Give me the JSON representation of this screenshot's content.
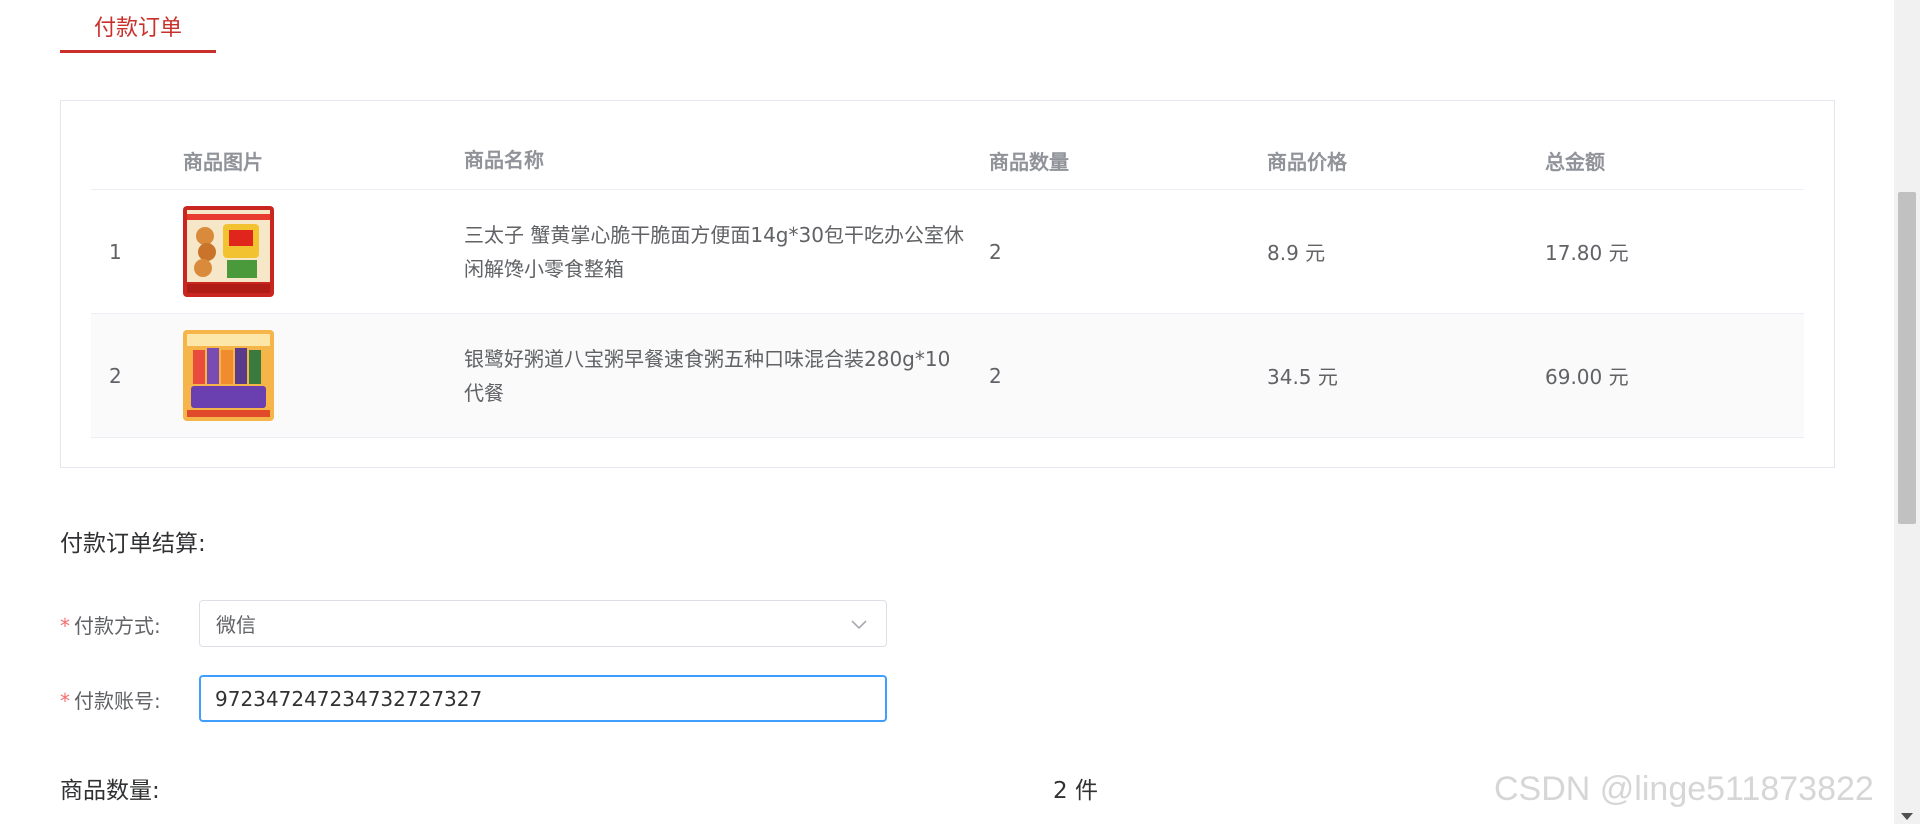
{
  "tabs": {
    "active_label": "付款订单"
  },
  "table": {
    "headers": [
      "",
      "商品图片",
      "商品名称",
      "商品数量",
      "商品价格",
      "总金额"
    ],
    "rows": [
      {
        "index": "1",
        "image_icon": "snack-product-image",
        "name": "三太子 蟹黄掌心脆干脆面方便面14g*30包干吃办公室休闲解馋小零食整箱",
        "quantity": "2",
        "price": "8.9 元",
        "total": "17.80 元"
      },
      {
        "index": "2",
        "image_icon": "porridge-product-image",
        "name": "银鹭好粥道八宝粥早餐速食粥五种口味混合装280g*10代餐",
        "quantity": "2",
        "price": "34.5 元",
        "total": "69.00 元"
      }
    ]
  },
  "section": {
    "title": "付款订单结算:"
  },
  "form": {
    "required_mark": "*",
    "payment_method_label": "付款方式:",
    "payment_method_value": "微信",
    "payment_account_label": "付款账号:",
    "payment_account_value": "972347247234732727327"
  },
  "summary": {
    "quantity_label": "商品数量:",
    "quantity_value": "2 件"
  },
  "watermark": "CSDN @linge511873822",
  "colors": {
    "accent": "#c9302c",
    "focus": "#409eff",
    "required": "#f56c6c"
  }
}
